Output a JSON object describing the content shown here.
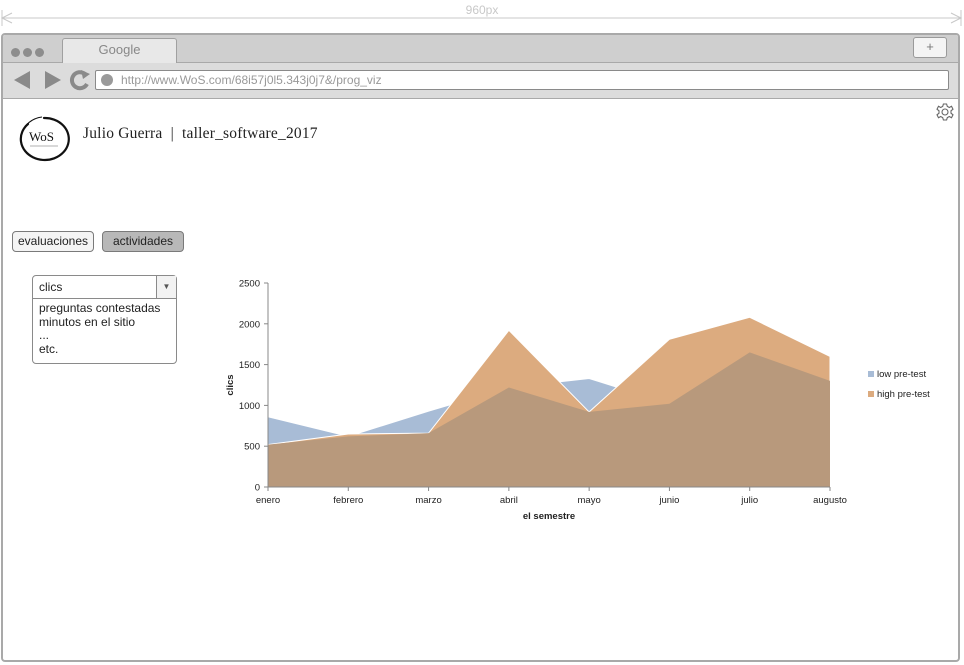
{
  "ruler": {
    "label": "960px"
  },
  "browser": {
    "tab_title": "Google",
    "new_tab_label": "+",
    "url": "http://www.WoS.com/68i57j0l5.343j0j7&/prog_viz"
  },
  "header": {
    "logo_text": "WoS",
    "title": "Julio Guerra  |  taller_software_2017"
  },
  "tabs": {
    "evaluaciones": "evaluaciones",
    "actividades": "actividades"
  },
  "metric_select": {
    "selected": "clics",
    "options": [
      "preguntas contestadas",
      "minutos en el sitio",
      "...",
      "etc."
    ]
  },
  "colors": {
    "low": "#a8bcd6",
    "high": "#dcab7f",
    "overlap": "#b8997c"
  },
  "chart_data": {
    "type": "area",
    "categories": [
      "enero",
      "febrero",
      "marzo",
      "abril",
      "mayo",
      "junio",
      "julio",
      "augusto"
    ],
    "series": [
      {
        "name": "low pre-test",
        "values": [
          860,
          620,
          930,
          1220,
          1330,
          1020,
          1650,
          1300
        ]
      },
      {
        "name": "high pre-test",
        "values": [
          520,
          650,
          660,
          1920,
          920,
          1810,
          2080,
          1600
        ]
      }
    ],
    "yticks": [
      0,
      500,
      1000,
      1500,
      2000,
      2500
    ],
    "ylim": [
      0,
      2500
    ],
    "xlabel": "el semestre",
    "ylabel": "clics",
    "legend": "right"
  }
}
